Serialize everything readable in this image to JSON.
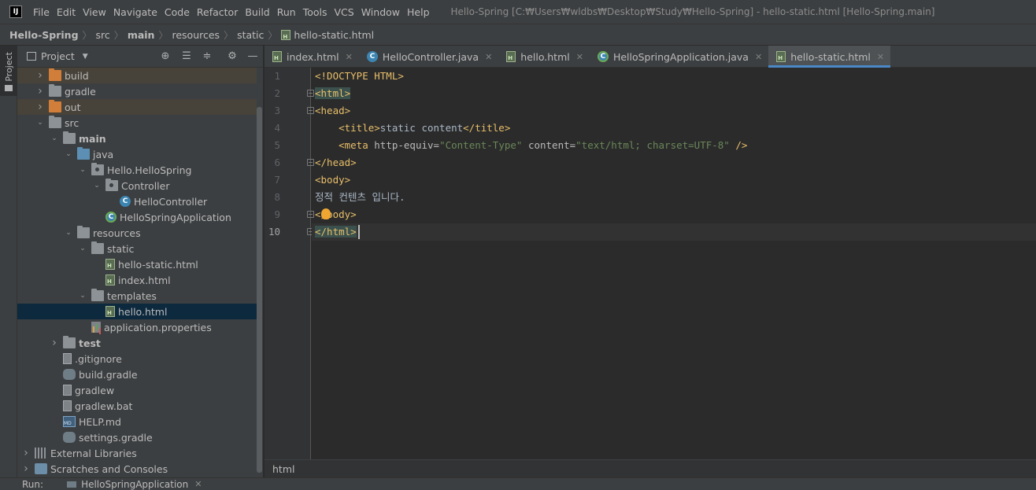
{
  "menu": {
    "items": [
      "File",
      "Edit",
      "View",
      "Navigate",
      "Code",
      "Refactor",
      "Build",
      "Run",
      "Tools",
      "VCS",
      "Window",
      "Help"
    ],
    "window_title": "Hello-Spring [C:₩Users₩wldbs₩Desktop₩Study₩Hello-Spring] - hello-static.html [Hello-Spring.main]"
  },
  "navbar": {
    "crumbs": [
      "Hello-Spring",
      "src",
      "main",
      "resources",
      "static",
      "hello-static.html"
    ]
  },
  "side_strip": {
    "project_tab": "Project"
  },
  "project_panel": {
    "title": "Project",
    "tree": [
      {
        "label": "build",
        "depth": 1,
        "arrow": "right",
        "icon": "folder-orange"
      },
      {
        "label": "gradle",
        "depth": 1,
        "arrow": "right",
        "icon": "folder"
      },
      {
        "label": "out",
        "depth": 1,
        "arrow": "right",
        "icon": "folder-orange"
      },
      {
        "label": "src",
        "depth": 1,
        "arrow": "down",
        "icon": "folder"
      },
      {
        "label": "main",
        "depth": 2,
        "arrow": "down",
        "icon": "folder",
        "bold": true
      },
      {
        "label": "java",
        "depth": 3,
        "arrow": "down",
        "icon": "folder-blue"
      },
      {
        "label": "Hello.HelloSpring",
        "depth": 4,
        "arrow": "down",
        "icon": "package"
      },
      {
        "label": "Controller",
        "depth": 5,
        "arrow": "down",
        "icon": "package"
      },
      {
        "label": "HelloController",
        "depth": 6,
        "arrow": "none",
        "icon": "class"
      },
      {
        "label": "HelloSpringApplication",
        "depth": 5,
        "arrow": "none",
        "icon": "class-spring"
      },
      {
        "label": "resources",
        "depth": 3,
        "arrow": "down",
        "icon": "folder-res"
      },
      {
        "label": "static",
        "depth": 4,
        "arrow": "down",
        "icon": "folder"
      },
      {
        "label": "hello-static.html",
        "depth": 5,
        "arrow": "none",
        "icon": "html"
      },
      {
        "label": "index.html",
        "depth": 5,
        "arrow": "none",
        "icon": "html"
      },
      {
        "label": "templates",
        "depth": 4,
        "arrow": "down",
        "icon": "folder"
      },
      {
        "label": "hello.html",
        "depth": 5,
        "arrow": "none",
        "icon": "html"
      },
      {
        "label": "application.properties",
        "depth": 4,
        "arrow": "none",
        "icon": "properties"
      },
      {
        "label": "test",
        "depth": 2,
        "arrow": "right",
        "icon": "folder",
        "bold": true
      },
      {
        "label": ".gitignore",
        "depth": 2,
        "arrow": "none",
        "icon": "plain"
      },
      {
        "label": "build.gradle",
        "depth": 2,
        "arrow": "none",
        "icon": "gradle"
      },
      {
        "label": "gradlew",
        "depth": 2,
        "arrow": "none",
        "icon": "plain"
      },
      {
        "label": "gradlew.bat",
        "depth": 2,
        "arrow": "none",
        "icon": "plain"
      },
      {
        "label": "HELP.md",
        "depth": 2,
        "arrow": "none",
        "icon": "md"
      },
      {
        "label": "settings.gradle",
        "depth": 2,
        "arrow": "none",
        "icon": "gradle"
      },
      {
        "label": "External Libraries",
        "depth": 0,
        "arrow": "right",
        "icon": "library"
      },
      {
        "label": "Scratches and Consoles",
        "depth": 0,
        "arrow": "right",
        "icon": "scratch"
      }
    ]
  },
  "tabs": [
    {
      "label": "index.html",
      "icon": "html",
      "active": false
    },
    {
      "label": "HelloController.java",
      "icon": "class",
      "active": false
    },
    {
      "label": "hello.html",
      "icon": "html",
      "active": false
    },
    {
      "label": "HelloSpringApplication.java",
      "icon": "class-spring",
      "active": false
    },
    {
      "label": "hello-static.html",
      "icon": "html",
      "active": true
    }
  ],
  "editor": {
    "line_numbers": [
      "1",
      "2",
      "3",
      "4",
      "5",
      "6",
      "7",
      "8",
      "9",
      "10"
    ],
    "lines": {
      "l1": "<!DOCTYPE HTML>",
      "l2": "<html>",
      "l3": "<head>",
      "l4_indent": "    ",
      "l4_open": "<title>",
      "l4_text": "static content",
      "l4_close": "</title>",
      "l5_indent": "    ",
      "l5_tag": "<meta ",
      "l5_attr1": "http-equiv=",
      "l5_val1": "\"Content-Type\"",
      "l5_attr2": " content=",
      "l5_val2": "\"text/html; charset=UTF-8\"",
      "l5_end": " />",
      "l6": "</head>",
      "l7": "<body>",
      "l8": "정적 컨텐츠 입니다.",
      "l9": "</body>",
      "l10": "</html>"
    }
  },
  "editor_breadcrumb": "html",
  "bottom": {
    "run_label": "Run:",
    "run_config": "HelloSpringApplication"
  }
}
